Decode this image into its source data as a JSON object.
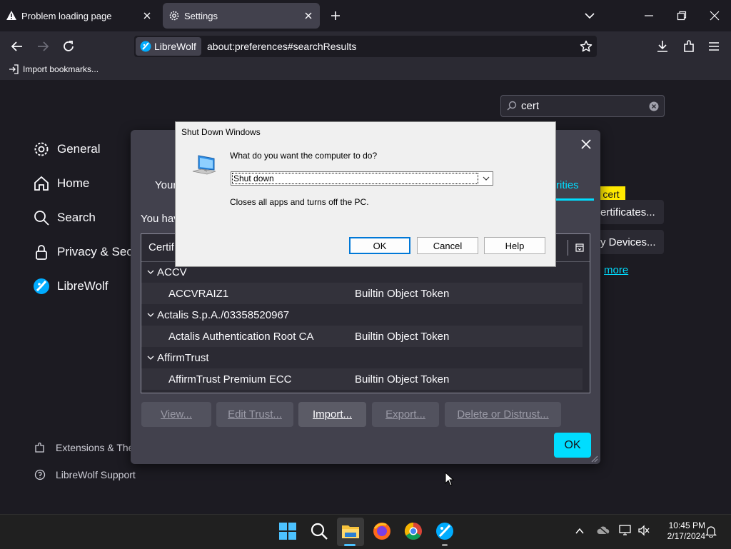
{
  "tabs": [
    {
      "label": "Problem loading page",
      "icon": "warning-icon"
    },
    {
      "label": "Settings",
      "icon": "gear-icon"
    }
  ],
  "urlbar": {
    "identity": "LibreWolf",
    "url": "about:preferences#searchResults"
  },
  "bookmarks": {
    "import_label": "Import bookmarks..."
  },
  "search": {
    "value": "cert"
  },
  "sidebar": {
    "items": [
      {
        "label": "General",
        "icon": "gear-icon"
      },
      {
        "label": "Home",
        "icon": "home-icon"
      },
      {
        "label": "Search",
        "icon": "search-icon"
      },
      {
        "label": "Privacy & Secu",
        "icon": "lock-icon"
      },
      {
        "label": "LibreWolf",
        "icon": "librewolf-icon"
      }
    ],
    "footer": [
      {
        "label": "Extensions & The",
        "icon": "puzzle-icon"
      },
      {
        "label": "LibreWolf Support",
        "icon": "help-icon"
      }
    ]
  },
  "bg_content": {
    "cert_highlight": "cert",
    "view_certs": "ertificates...",
    "security_devices": "y Devices...",
    "learn_more": "more"
  },
  "cert_dialog": {
    "tab_left": "Your",
    "tab_right": "rities",
    "intro": "You hav",
    "col_header": "Certif",
    "rows": [
      {
        "type": "group",
        "name": "ACCV"
      },
      {
        "type": "item",
        "name": "ACCVRAIZ1",
        "token": "Builtin Object Token"
      },
      {
        "type": "group",
        "name": "Actalis S.p.A./03358520967"
      },
      {
        "type": "item",
        "name": "Actalis Authentication Root CA",
        "token": "Builtin Object Token"
      },
      {
        "type": "group",
        "name": "AffirmTrust"
      },
      {
        "type": "item",
        "name": "AffirmTrust Premium ECC",
        "token": "Builtin Object Token"
      }
    ],
    "buttons": {
      "view": "View...",
      "edit_trust": "Edit Trust...",
      "import": "Import...",
      "export": "Export...",
      "delete": "Delete or Distrust..."
    },
    "ok": "OK"
  },
  "shutdown_dialog": {
    "title": "Shut Down Windows",
    "question": "What do you want the computer to do?",
    "selected": "Shut down",
    "description": "Closes all apps and turns off the PC.",
    "ok": "OK",
    "cancel": "Cancel",
    "help": "Help"
  },
  "taskbar": {
    "time": "10:45 PM",
    "date": "2/17/2024"
  },
  "colors": {
    "accent": "#00ddff",
    "highlight": "#ffe900"
  }
}
